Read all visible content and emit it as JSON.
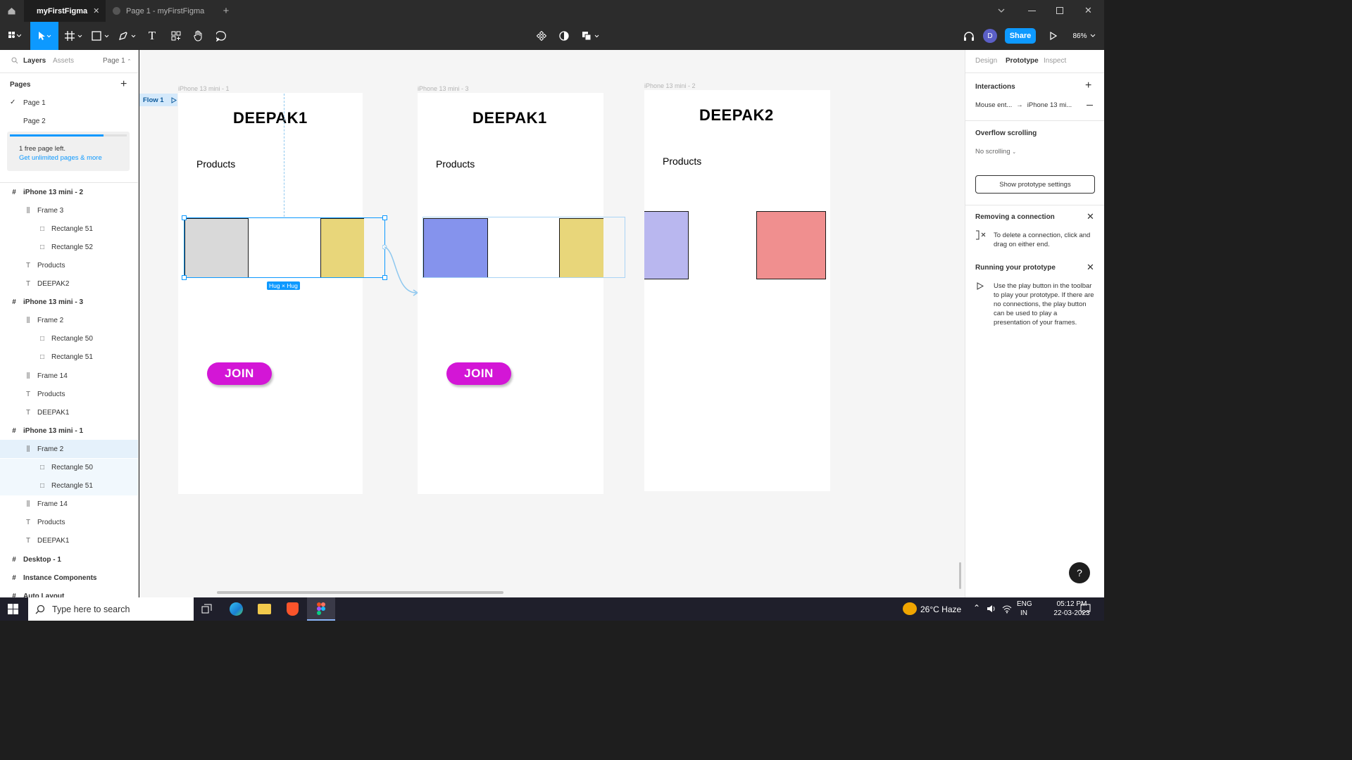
{
  "tabs": [
    {
      "label": "myFirstFigma",
      "active": true
    },
    {
      "label": "Page 1 - myFirstFigma",
      "active": false
    }
  ],
  "toolbar": {
    "share_label": "Share",
    "zoom": "86%",
    "avatar_initial": "D"
  },
  "left_panel": {
    "tab_layers": "Layers",
    "tab_assets": "Assets",
    "page_selector": "Page 1",
    "pages_heading": "Pages",
    "pages": [
      "Page 1",
      "Page 2"
    ],
    "upgrade": {
      "text": "1 free page left.",
      "link": "Get unlimited pages & more",
      "progress": 0.8
    },
    "layers": [
      {
        "label": "iPhone 13 mini - 2",
        "type": "frame",
        "level": 0
      },
      {
        "label": "Frame 3",
        "type": "autolayout",
        "level": 1
      },
      {
        "label": "Rectangle 51",
        "type": "rect",
        "level": 2
      },
      {
        "label": "Rectangle 52",
        "type": "rect",
        "level": 2
      },
      {
        "label": "Products",
        "type": "text",
        "level": 1
      },
      {
        "label": "DEEPAK2",
        "type": "text",
        "level": 1
      },
      {
        "label": "iPhone 13 mini - 3",
        "type": "frame",
        "level": 0
      },
      {
        "label": "Frame 2",
        "type": "autolayout",
        "level": 1
      },
      {
        "label": "Rectangle 50",
        "type": "rect",
        "level": 2
      },
      {
        "label": "Rectangle 51",
        "type": "rect",
        "level": 2
      },
      {
        "label": "Frame 14",
        "type": "autolayout",
        "level": 1
      },
      {
        "label": "Products",
        "type": "text",
        "level": 1
      },
      {
        "label": "DEEPAK1",
        "type": "text",
        "level": 1
      },
      {
        "label": "iPhone 13 mini - 1",
        "type": "frame",
        "level": 0
      },
      {
        "label": "Frame 2",
        "type": "autolayout",
        "level": 1,
        "state": "selected"
      },
      {
        "label": "Rectangle 50",
        "type": "rect",
        "level": 2,
        "state": "child"
      },
      {
        "label": "Rectangle 51",
        "type": "rect",
        "level": 2,
        "state": "child"
      },
      {
        "label": "Frame 14",
        "type": "autolayout",
        "level": 1
      },
      {
        "label": "Products",
        "type": "text",
        "level": 1
      },
      {
        "label": "DEEPAK1",
        "type": "text",
        "level": 1
      },
      {
        "label": "Desktop - 1",
        "type": "frame",
        "level": 0
      },
      {
        "label": "Instance Components",
        "type": "frame",
        "level": 0
      },
      {
        "label": "Auto Layout",
        "type": "frame",
        "level": 0
      }
    ]
  },
  "canvas": {
    "flow_label": "Flow 1",
    "hug_label": "Hug × Hug",
    "frames": [
      {
        "label": "iPhone 13 mini - 1",
        "title": "DEEPAK1",
        "products": "Products",
        "join": "JOIN",
        "colors": [
          "#d9d9d9",
          "#e8d67a"
        ]
      },
      {
        "label": "iPhone 13 mini - 3",
        "title": "DEEPAK1",
        "products": "Products",
        "join": "JOIN",
        "colors": [
          "#8593ed",
          "#e8d67a"
        ]
      },
      {
        "label": "iPhone 13 mini - 2",
        "title": "DEEPAK2",
        "products": "Products",
        "colors": [
          "#b9b7ef",
          "#f08f8f"
        ]
      }
    ]
  },
  "right_panel": {
    "tabs": [
      "Design",
      "Prototype",
      "Inspect"
    ],
    "active_tab": "Prototype",
    "interactions_heading": "Interactions",
    "interaction": {
      "trigger": "Mouse ent...",
      "target": "iPhone 13 mi..."
    },
    "overflow_heading": "Overflow scrolling",
    "overflow_value": "No scrolling",
    "settings_button": "Show prototype settings",
    "removing_heading": "Removing a connection",
    "removing_text": "To delete a connection, click and drag on either end.",
    "running_heading": "Running your prototype",
    "running_text": "Use the play button in the toolbar to play your prototype. If there are no connections, the play button can be used to play a presentation of your frames.",
    "help": "?"
  },
  "taskbar": {
    "search_placeholder": "Type here to search",
    "weather": "26°C Haze",
    "lang": "ENG",
    "region": "IN",
    "time": "05:12 PM",
    "date": "22-03-2023"
  },
  "colors": {
    "accent": "#0d99ff",
    "join": "#d316d6",
    "selection": "#e5f1fb"
  }
}
